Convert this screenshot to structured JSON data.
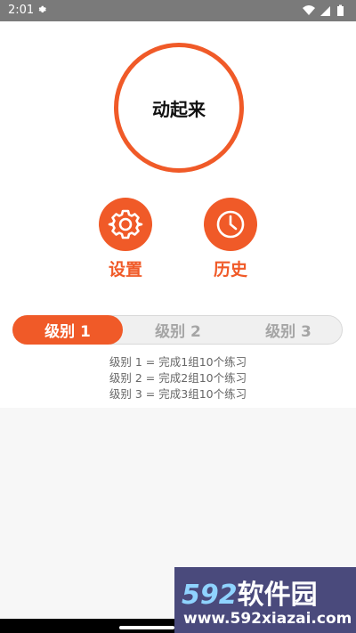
{
  "status_bar": {
    "time": "2:01",
    "icons": [
      "settings-gear-icon",
      "wifi-icon",
      "cellular-signal-icon",
      "battery-icon"
    ]
  },
  "start_button": {
    "label": "动起来"
  },
  "settings_button": {
    "icon": "gear-icon",
    "label": "设置"
  },
  "history_button": {
    "icon": "clock-icon",
    "label": "历史"
  },
  "levels": {
    "items": [
      {
        "label": "级别 1",
        "selected": true
      },
      {
        "label": "级别 2",
        "selected": false
      },
      {
        "label": "级别 3",
        "selected": false
      }
    ],
    "descriptions": [
      "级别 1 = 完成1组10个练习",
      "级别 2 = 完成2组10个练习",
      "级别 3 = 完成3组10个练习"
    ]
  },
  "watermark": {
    "brand_number": "592",
    "brand_text": "软件园",
    "url": "www.592xiazai.com"
  },
  "colors": {
    "accent": "#f05a28",
    "status_bar": "#7a7a7a",
    "watermark_bg": "#4a4a7c"
  }
}
